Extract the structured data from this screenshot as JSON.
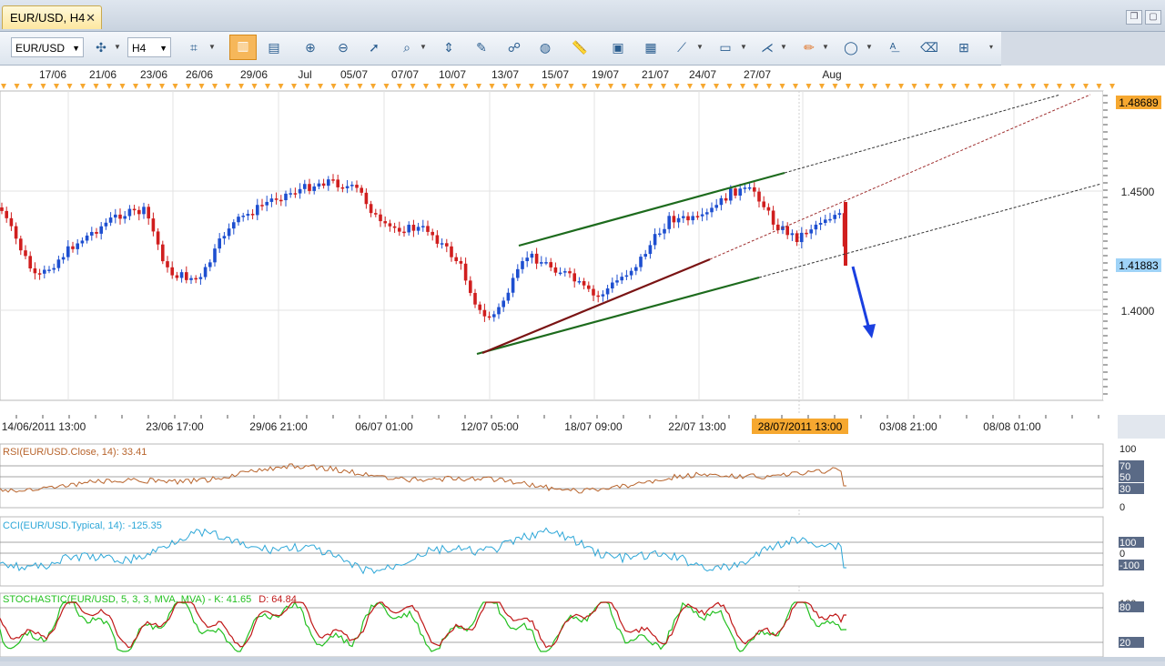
{
  "tab": {
    "title": "EUR/USD, H4",
    "close": "✕"
  },
  "toolbar": {
    "symbol": "EUR/USD",
    "timeframe": "H4"
  },
  "top_dates": [
    "17/06",
    "21/06",
    "23/06",
    "26/06",
    "29/06",
    "Jul",
    "05/07",
    "07/07",
    "10/07",
    "13/07",
    "15/07",
    "19/07",
    "21/07",
    "24/07",
    "27/07",
    "Aug"
  ],
  "bottom_dates": [
    "14/06/2011 13:00",
    "23/06 17:00",
    "29/06 21:00",
    "06/07 01:00",
    "12/07 05:00",
    "18/07 09:00",
    "22/07 13:00",
    "28/07/2011 13:00",
    "03/08 21:00",
    "08/08 01:00"
  ],
  "price_labels": {
    "high": "1.48689",
    "p1": "1.4500",
    "current": "1.41883",
    "p2": "1.4000"
  },
  "rsi": {
    "title": "RSI(EUR/USD.Close, 14): 33.41",
    "ticks": [
      "100",
      "70",
      "50",
      "30",
      "0"
    ]
  },
  "cci": {
    "title": "CCI(EUR/USD.Typical, 14): -125.35",
    "ticks": [
      "100",
      "0",
      "-100"
    ]
  },
  "stoch": {
    "title": "STOCHASTIC(EUR/USD, 5, 3, 3, MVA, MVA) - ",
    "k": "K: 41.65",
    "d": "D: 64.84",
    "ticks": [
      "100",
      "80",
      "20"
    ]
  },
  "colors": {
    "up": "#1e4fd0",
    "down": "#d01e1e",
    "rsi": "#b8642c",
    "cci": "#2da7d8",
    "stoch_k": "#23c020",
    "stoch_d": "#c01818",
    "accent": "#f6a830"
  }
}
